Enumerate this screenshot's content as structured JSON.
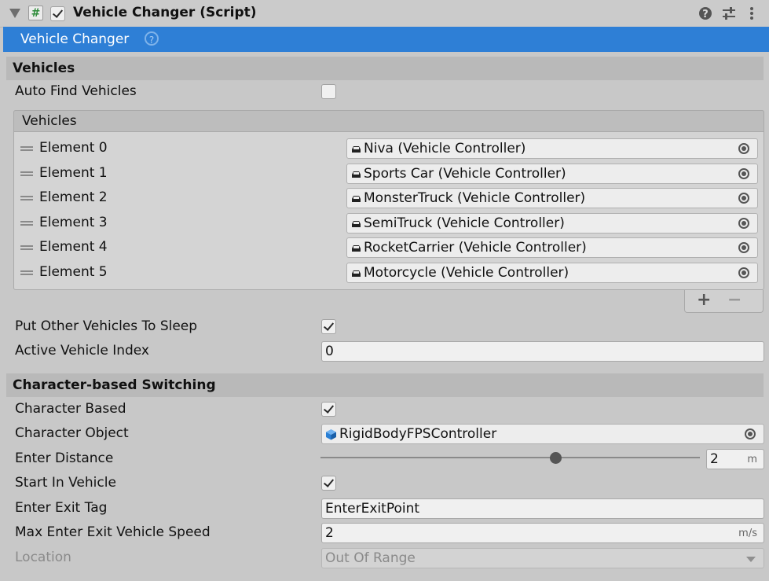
{
  "component": {
    "title": "Vehicle Changer (Script)",
    "banner_label": "Vehicle Changer",
    "banner_help": "?"
  },
  "vehicles_section": {
    "header": "Vehicles",
    "auto_find_label": "Auto Find Vehicles",
    "auto_find_checked": false,
    "list_header": "Vehicles",
    "elements": [
      {
        "label": "Element 0",
        "value": "Niva (Vehicle Controller)"
      },
      {
        "label": "Element 1",
        "value": "Sports Car (Vehicle Controller)"
      },
      {
        "label": "Element 2",
        "value": "MonsterTruck (Vehicle Controller)"
      },
      {
        "label": "Element 3",
        "value": "SemiTruck (Vehicle Controller)"
      },
      {
        "label": "Element 4",
        "value": "RocketCarrier (Vehicle Controller)"
      },
      {
        "label": "Element 5",
        "value": "Motorcycle (Vehicle Controller)"
      }
    ],
    "add_label": "+",
    "remove_label": "−",
    "sleep_label": "Put Other Vehicles To Sleep",
    "sleep_checked": true,
    "active_index_label": "Active Vehicle Index",
    "active_index_value": "0"
  },
  "character_section": {
    "header": "Character-based Switching",
    "character_based_label": "Character Based",
    "character_based_checked": true,
    "character_object_label": "Character Object",
    "character_object_value": "RigidBodyFPSController",
    "enter_distance_label": "Enter Distance",
    "enter_distance_value": "2",
    "enter_distance_unit": "m",
    "enter_distance_slider_fraction": 0.62,
    "start_in_vehicle_label": "Start In Vehicle",
    "start_in_vehicle_checked": true,
    "enter_exit_tag_label": "Enter Exit Tag",
    "enter_exit_tag_value": "EnterExitPoint",
    "max_speed_label": "Max Enter Exit Vehicle Speed",
    "max_speed_value": "2",
    "max_speed_unit": "m/s",
    "location_label": "Location",
    "location_value": "Out Of Range"
  },
  "colors": {
    "banner": "#2e7fd6",
    "background": "#c8c8c8",
    "section": "#b9b9b9"
  }
}
